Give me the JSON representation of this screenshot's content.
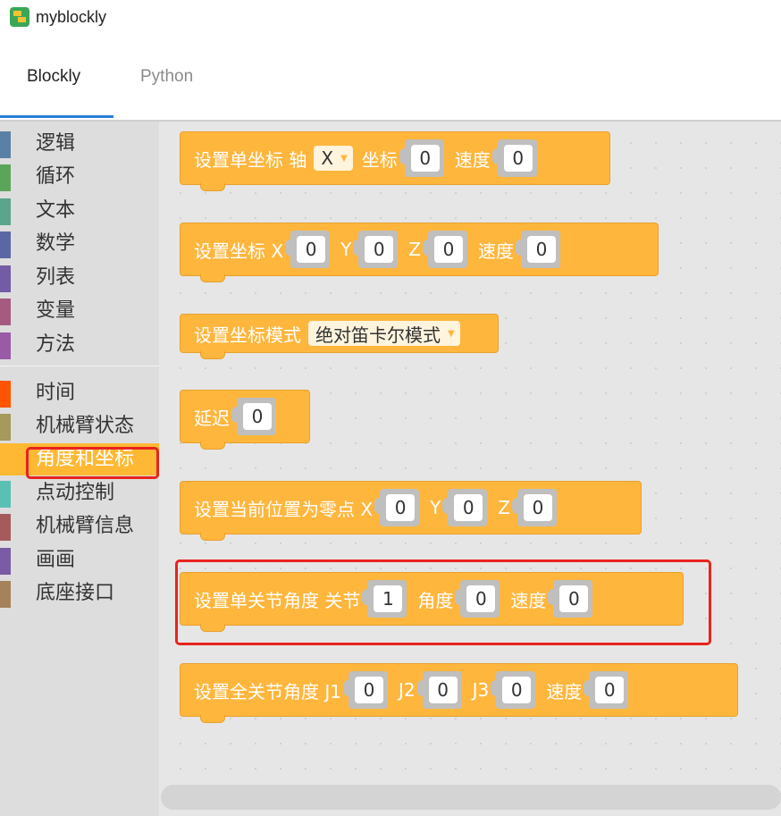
{
  "app": {
    "title": "myblockly"
  },
  "tabs": [
    {
      "label": "Blockly"
    },
    {
      "label": "Python"
    }
  ],
  "toolbox": {
    "categories": [
      {
        "label": "逻辑",
        "color": "#5b80a5"
      },
      {
        "label": "循环",
        "color": "#5ba55b"
      },
      {
        "label": "文本",
        "color": "#5ba58c"
      },
      {
        "label": "数学",
        "color": "#5b67a5"
      },
      {
        "label": "列表",
        "color": "#745ba5"
      },
      {
        "label": "变量",
        "color": "#a55b80"
      },
      {
        "label": "方法",
        "color": "#995ba5"
      },
      {
        "label": "时间",
        "color": "#ff5400"
      },
      {
        "label": "机械臂状态",
        "color": "#a5995b"
      },
      {
        "label": "角度和坐标",
        "color": "#ffb833"
      },
      {
        "label": "点动控制",
        "color": "#5bc0b4"
      },
      {
        "label": "机械臂信息",
        "color": "#a55b5b"
      },
      {
        "label": "画画",
        "color": "#7a5ba5"
      },
      {
        "label": "底座接口",
        "color": "#a5825b"
      }
    ],
    "selected": "角度和坐标"
  },
  "blocks": {
    "b1": {
      "t1": "设置单坐标 轴",
      "axis": "X",
      "t2": "坐标",
      "v1": "0",
      "t3": "速度",
      "v2": "0"
    },
    "b2": {
      "t1": "设置坐标 X",
      "v1": "0",
      "t2": "Y",
      "v2": "0",
      "t3": "Z",
      "v3": "0",
      "t4": "速度",
      "v4": "0"
    },
    "b3": {
      "t1": "设置坐标模式",
      "mode": "绝对笛卡尔模式"
    },
    "b4": {
      "t1": "延迟",
      "v1": "0"
    },
    "b5": {
      "t1": "设置当前位置为零点 X",
      "v1": "0",
      "t2": "Y",
      "v2": "0",
      "t3": "Z",
      "v3": "0"
    },
    "b6": {
      "t1": "设置单关节角度 关节",
      "v1": "1",
      "t2": "角度",
      "v2": "0",
      "t3": "速度",
      "v3": "0"
    },
    "b7": {
      "t1": "设置全关节角度 J1",
      "v1": "0",
      "t2": "J2",
      "v2": "0",
      "t3": "J3",
      "v3": "0",
      "t4": "速度",
      "v4": "0"
    }
  },
  "colors": {
    "block": "#ffb63d",
    "highlight": "#e8231e",
    "tab_accent": "#2a7fd4"
  }
}
